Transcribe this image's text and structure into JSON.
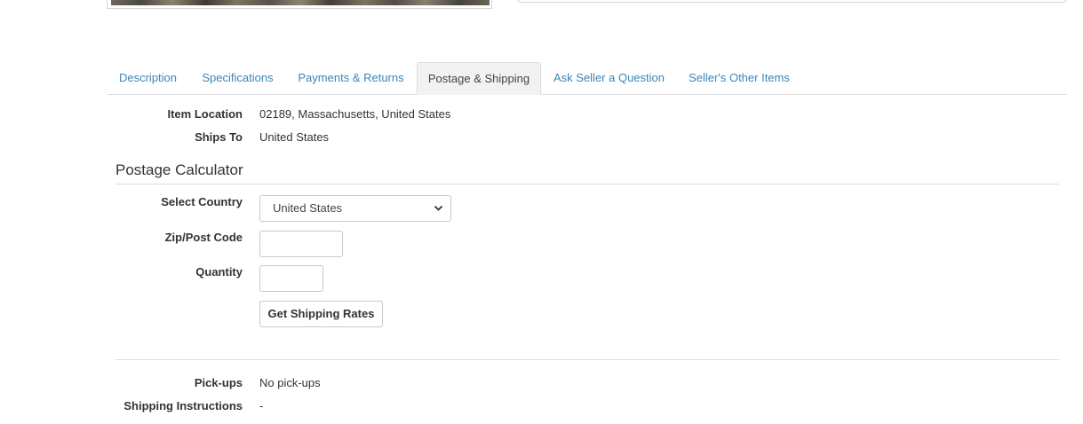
{
  "tabs": [
    {
      "label": "Description",
      "active": false
    },
    {
      "label": "Specifications",
      "active": false
    },
    {
      "label": "Payments & Returns",
      "active": false
    },
    {
      "label": "Postage & Shipping",
      "active": true
    },
    {
      "label": "Ask Seller a Question",
      "active": false
    },
    {
      "label": "Seller's Other Items",
      "active": false
    }
  ],
  "shipping": {
    "item_location_label": "Item Location",
    "item_location_value": "02189, Massachusetts, United States",
    "ships_to_label": "Ships To",
    "ships_to_value": "United States"
  },
  "calculator": {
    "title": "Postage Calculator",
    "country_label": "Select Country",
    "country_selected": "United States",
    "zip_label": "Zip/Post Code",
    "zip_value": "",
    "quantity_label": "Quantity",
    "quantity_value": "",
    "submit_label": "Get Shipping Rates"
  },
  "extra": {
    "pickups_label": "Pick-ups",
    "pickups_value": "No pick-ups",
    "instructions_label": "Shipping Instructions",
    "instructions_value": "-"
  },
  "colors": {
    "link": "#3a86b9",
    "active_tab_bg": "#f2f2f2",
    "border": "#dddddd"
  }
}
